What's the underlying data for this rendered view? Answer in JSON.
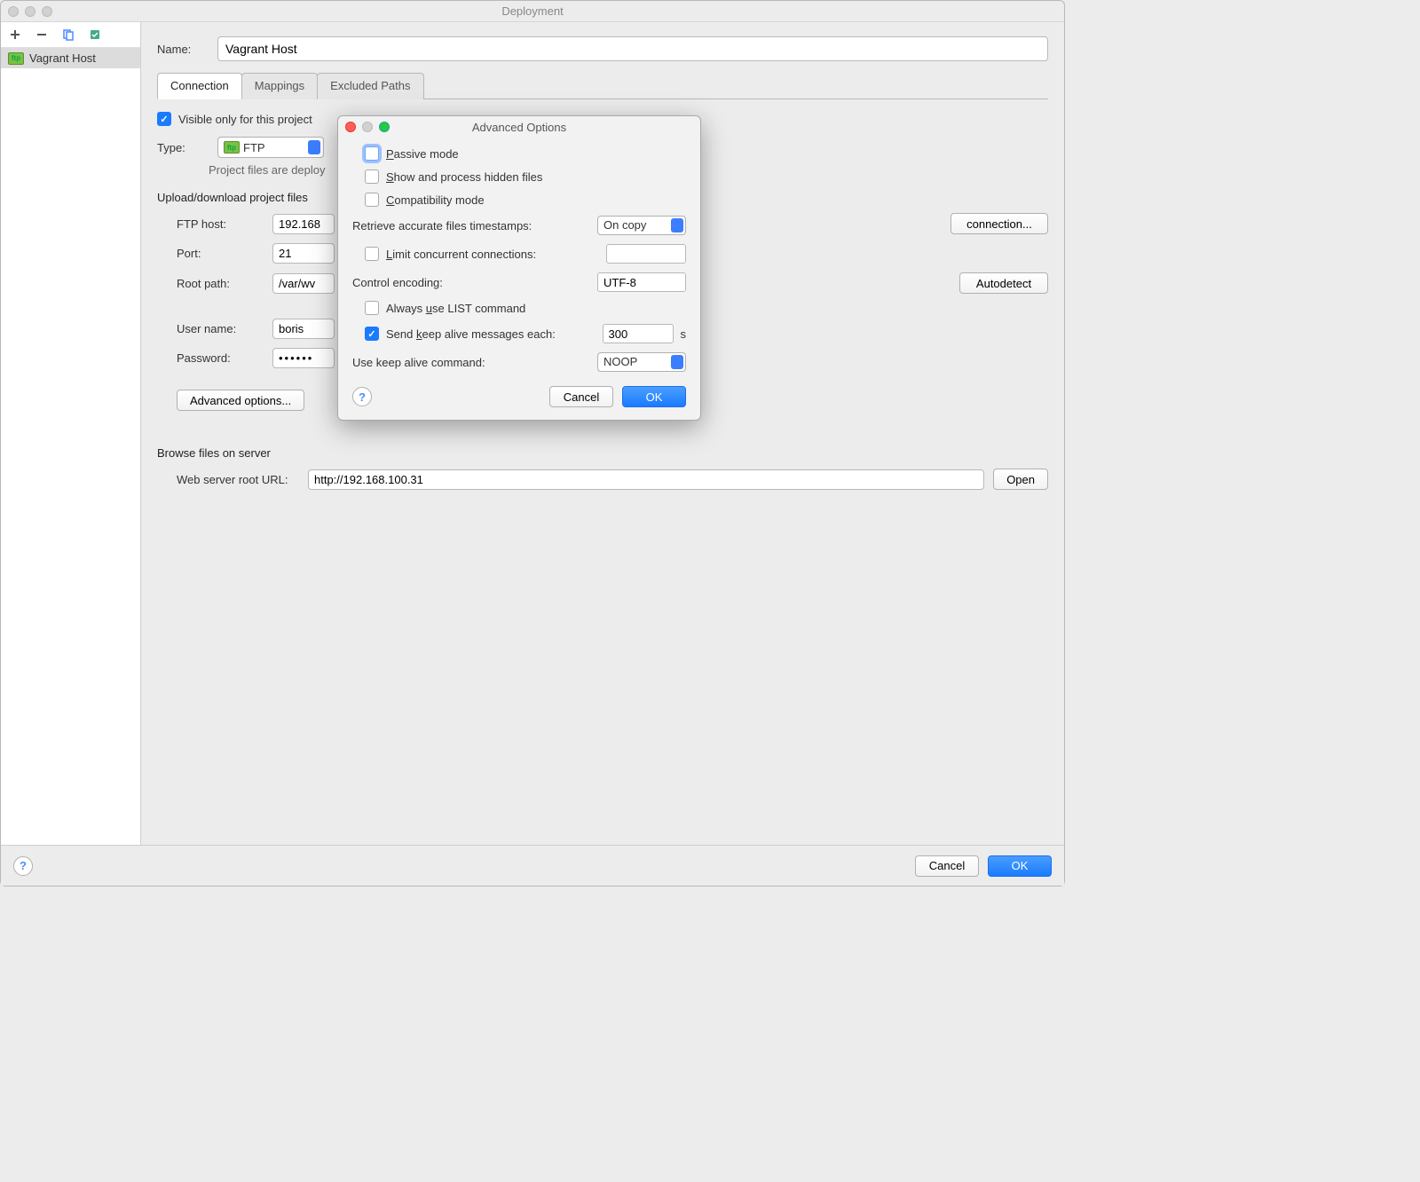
{
  "window": {
    "title": "Deployment"
  },
  "sidebar": {
    "items": [
      {
        "label": "Vagrant Host",
        "icon": "ftp"
      }
    ]
  },
  "main": {
    "name_label": "Name:",
    "name_value": "Vagrant Host",
    "tabs": [
      {
        "label": "Connection",
        "active": true
      },
      {
        "label": "Mappings",
        "active": false
      },
      {
        "label": "Excluded Paths",
        "active": false
      }
    ],
    "visible_only_label": "Visible only for this project",
    "visible_only_checked": true,
    "type_label": "Type:",
    "type_value": "FTP",
    "hint": "Project files are deploy",
    "upload_title": "Upload/download project files",
    "ftp_host_label": "FTP host:",
    "ftp_host_value": "192.168",
    "port_label": "Port:",
    "port_value": "21",
    "root_path_label": "Root path:",
    "root_path_value": "/var/wv",
    "user_name_label": "User name:",
    "user_name_value": "boris",
    "password_label": "Password:",
    "password_value": "••••••",
    "advanced_button": "Advanced options...",
    "test_connection_button": "connection...",
    "autodetect_button": "Autodetect",
    "browse_title": "Browse files on server",
    "web_root_label": "Web server root URL:",
    "web_root_value": "http://192.168.100.31",
    "open_button": "Open"
  },
  "footer": {
    "cancel": "Cancel",
    "ok": "OK"
  },
  "modal": {
    "title": "Advanced Options",
    "passive_label": "Passive mode",
    "passive_checked": false,
    "show_hidden_label": "Show and process hidden files",
    "show_hidden_checked": false,
    "compat_label": "Compatibility mode",
    "compat_checked": false,
    "retrieve_label": "Retrieve accurate files timestamps:",
    "retrieve_value": "On copy",
    "limit_label": "Limit concurrent connections:",
    "limit_checked": false,
    "limit_value": "",
    "encoding_label": "Control encoding:",
    "encoding_value": "UTF-8",
    "always_list_label": "Always use LIST command",
    "always_list_checked": false,
    "keepalive_label": "Send keep alive messages each:",
    "keepalive_checked": true,
    "keepalive_value": "300",
    "keepalive_unit": "s",
    "keepalive_cmd_label": "Use keep alive command:",
    "keepalive_cmd_value": "NOOP",
    "cancel": "Cancel",
    "ok": "OK"
  }
}
